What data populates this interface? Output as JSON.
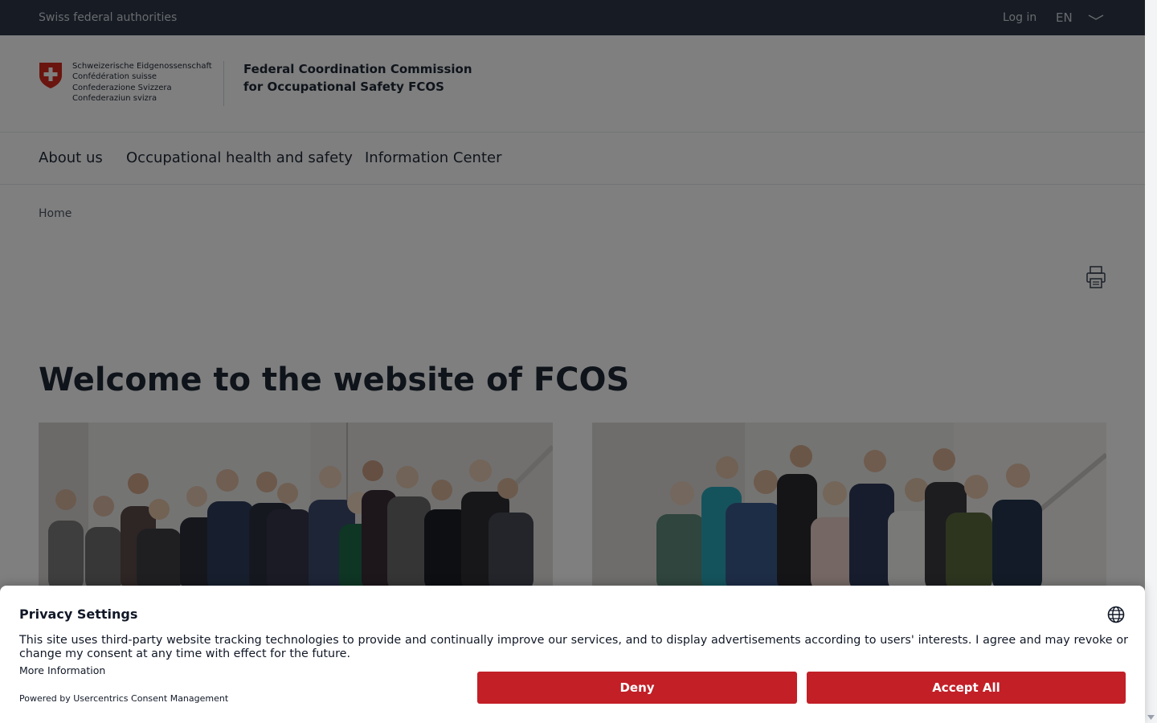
{
  "topbar": {
    "authorities": "Swiss federal authorities",
    "login": "Log in",
    "language": "EN"
  },
  "header": {
    "confederation_lines": [
      "Schweizerische Eidgenossenschaft",
      "Confédération suisse",
      "Confederazione Svizzera",
      "Confederaziun svizra"
    ],
    "title_line1": "Federal Coordination Commission",
    "title_line2": "for Occupational Safety FCOS"
  },
  "nav": {
    "items": [
      {
        "label": "About us"
      },
      {
        "label": "Occupational health and safety"
      },
      {
        "label": "Information Center"
      }
    ]
  },
  "breadcrumb": {
    "home": "Home"
  },
  "main": {
    "heading": "Welcome to the website of FCOS"
  },
  "consent": {
    "title": "Privacy Settings",
    "description": "This site uses third-party website tracking technologies to provide and continually improve our services, and to display advertisements according to users' interests. I agree and may revoke or change my consent at any time with effect for the future.",
    "more_info": "More Information",
    "powered_by": "Powered by Usercentrics Consent Management",
    "deny_label": "Deny",
    "accept_label": "Accept All"
  },
  "colors": {
    "topbar": "#2d3748",
    "swiss_red": "#d52b1e",
    "button_red": "#c21f27"
  }
}
